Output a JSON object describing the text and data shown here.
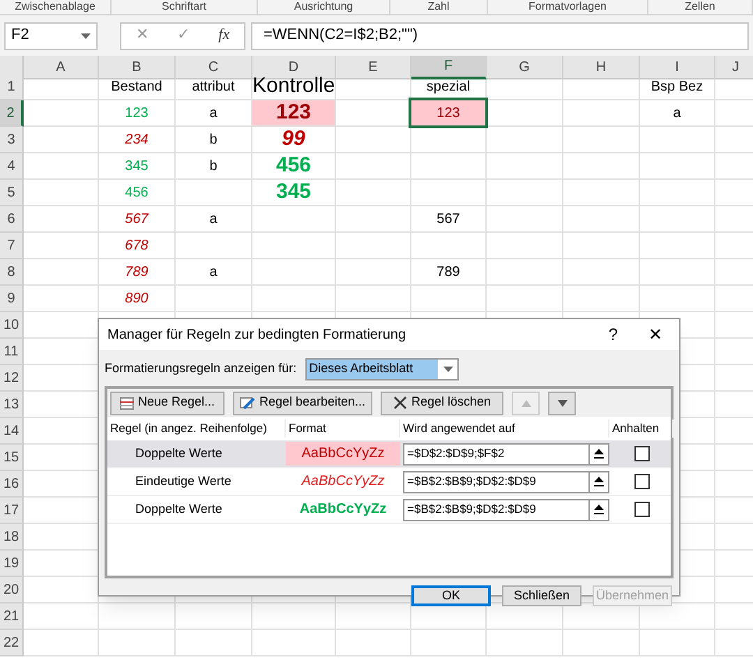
{
  "ribbon_groups": [
    "Zwischenablage",
    "Schriftart",
    "Ausrichtung",
    "Zahl",
    "Formatvorlagen",
    "Zellen"
  ],
  "name_box": "F2",
  "formula_bar": {
    "cancel": "✕",
    "enter": "✓",
    "fx": "fx",
    "formula": "=WENN(C2=I$2;B2;\"\")"
  },
  "columns": [
    {
      "label": "A",
      "selected": false
    },
    {
      "label": "B",
      "selected": false
    },
    {
      "label": "C",
      "selected": false
    },
    {
      "label": "D",
      "selected": false
    },
    {
      "label": "E",
      "selected": false
    },
    {
      "label": "F",
      "selected": true
    },
    {
      "label": "G",
      "selected": false
    },
    {
      "label": "H",
      "selected": false
    },
    {
      "label": "I",
      "selected": false
    },
    {
      "label": "J",
      "selected": false
    }
  ],
  "rows": [
    {
      "number": "1",
      "selected": false,
      "cells": {
        "B": {
          "text": "Bestand",
          "kind": "plain",
          "selected": false
        },
        "C": {
          "text": "attribut",
          "kind": "plain",
          "selected": false
        },
        "D": {
          "text": "Kontrolle",
          "kind": "plain",
          "selected": false
        },
        "F": {
          "text": "spezial",
          "kind": "plain",
          "selected": false
        },
        "I": {
          "text": "Bsp Bez",
          "kind": "plain",
          "selected": false
        }
      }
    },
    {
      "number": "2",
      "selected": true,
      "cells": {
        "B": {
          "text": "123",
          "kind": "green",
          "selected": false
        },
        "C": {
          "text": "a",
          "kind": "plain",
          "selected": false
        },
        "D": {
          "text": "123",
          "kind": "pink",
          "selected": false
        },
        "F": {
          "text": "123",
          "kind": "pink",
          "selected": true
        },
        "I": {
          "text": "a",
          "kind": "plain",
          "selected": false
        }
      }
    },
    {
      "number": "3",
      "selected": false,
      "cells": {
        "B": {
          "text": "234",
          "kind": "red",
          "selected": false
        },
        "C": {
          "text": "b",
          "kind": "plain",
          "selected": false
        },
        "D": {
          "text": "99",
          "kind": "red",
          "selected": false
        }
      }
    },
    {
      "number": "4",
      "selected": false,
      "cells": {
        "B": {
          "text": "345",
          "kind": "green",
          "selected": false
        },
        "C": {
          "text": "b",
          "kind": "plain",
          "selected": false
        },
        "D": {
          "text": "456",
          "kind": "green",
          "selected": false
        }
      }
    },
    {
      "number": "5",
      "selected": false,
      "cells": {
        "B": {
          "text": "456",
          "kind": "green",
          "selected": false
        },
        "D": {
          "text": "345",
          "kind": "green",
          "selected": false
        }
      }
    },
    {
      "number": "6",
      "selected": false,
      "cells": {
        "B": {
          "text": "567",
          "kind": "red",
          "selected": false
        },
        "C": {
          "text": "a",
          "kind": "plain",
          "selected": false
        },
        "F": {
          "text": "567",
          "kind": "plain",
          "selected": false
        }
      }
    },
    {
      "number": "7",
      "selected": false,
      "cells": {
        "B": {
          "text": "678",
          "kind": "red",
          "selected": false
        }
      }
    },
    {
      "number": "8",
      "selected": false,
      "cells": {
        "B": {
          "text": "789",
          "kind": "red",
          "selected": false
        },
        "C": {
          "text": "a",
          "kind": "plain",
          "selected": false
        },
        "F": {
          "text": "789",
          "kind": "plain",
          "selected": false
        }
      }
    },
    {
      "number": "9",
      "selected": false,
      "cells": {
        "B": {
          "text": "890",
          "kind": "red",
          "selected": false
        }
      }
    },
    {
      "number": "10",
      "selected": false,
      "cells": {}
    },
    {
      "number": "11",
      "selected": false,
      "cells": {}
    },
    {
      "number": "12",
      "selected": false,
      "cells": {}
    },
    {
      "number": "13",
      "selected": false,
      "cells": {}
    },
    {
      "number": "14",
      "selected": false,
      "cells": {}
    },
    {
      "number": "15",
      "selected": false,
      "cells": {}
    },
    {
      "number": "16",
      "selected": false,
      "cells": {}
    },
    {
      "number": "17",
      "selected": false,
      "cells": {}
    },
    {
      "number": "18",
      "selected": false,
      "cells": {}
    },
    {
      "number": "19",
      "selected": false,
      "cells": {}
    },
    {
      "number": "20",
      "selected": false,
      "cells": {}
    },
    {
      "number": "21",
      "selected": false,
      "cells": {}
    },
    {
      "number": "22",
      "selected": false,
      "cells": {}
    }
  ],
  "dialog": {
    "title": "Manager für Regeln zur bedingten Formatierung",
    "help": "?",
    "close": "✕",
    "show_for_label": "Formatierungsregeln anzeigen für:",
    "show_for_value": "Dieses Arbeitsblatt",
    "toolbar": [
      {
        "label": "Neue Regel...",
        "disabled": false
      },
      {
        "label": "Regel bearbeiten...",
        "disabled": false
      },
      {
        "label": "Regel löschen",
        "disabled": false
      }
    ],
    "move_buttons": [
      {
        "disabled": true
      },
      {
        "disabled": false
      }
    ],
    "headers": [
      "Regel (in angez. Reihenfolge)",
      "Format",
      "Wird angewendet auf",
      "Anhalten"
    ],
    "rules": [
      {
        "name": "Doppelte Werte",
        "preview": "AaBbCcYyZz",
        "kind": "pink",
        "applies_to": "=$D$2:$D$9;$F$2",
        "stop": false,
        "selected": true
      },
      {
        "name": "Eindeutige Werte",
        "preview": "AaBbCcYyZz",
        "kind": "red",
        "applies_to": "=$B$2:$B$9;$D$2:$D$9",
        "stop": false,
        "selected": false
      },
      {
        "name": "Doppelte Werte",
        "preview": "AaBbCcYyZz",
        "kind": "green",
        "applies_to": "=$B$2:$B$9;$D$2:$D$9",
        "stop": false,
        "selected": false
      }
    ],
    "buttons": [
      {
        "label": "OK",
        "default": true,
        "disabled": false
      },
      {
        "label": "Schließen",
        "default": false,
        "disabled": false
      },
      {
        "label": "Übernehmen",
        "default": false,
        "disabled": true
      }
    ]
  }
}
